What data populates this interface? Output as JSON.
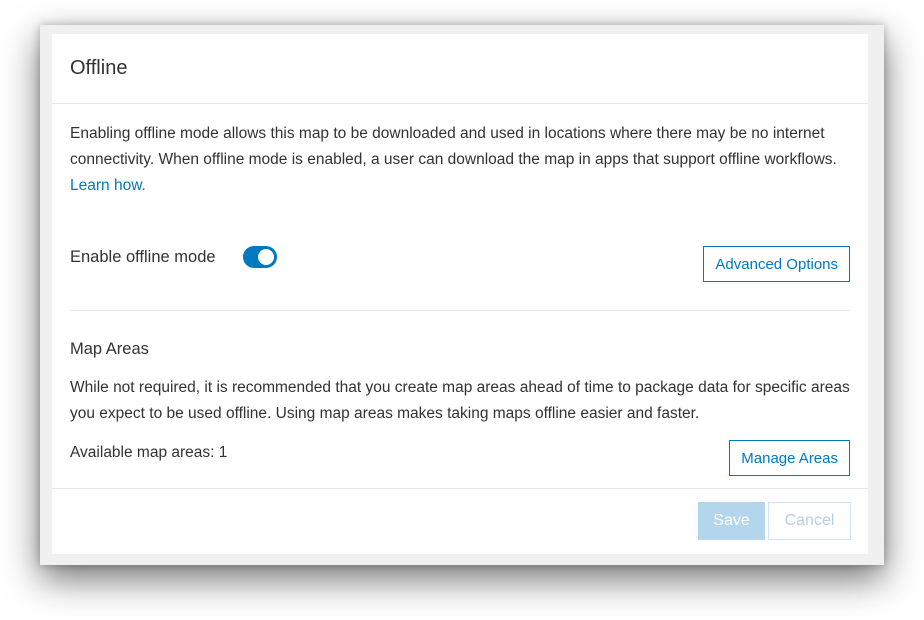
{
  "dialog": {
    "title": "Offline"
  },
  "offline": {
    "description": "Enabling offline mode allows this map to be downloaded and used in locations where there may be no internet connectivity. When offline mode is enabled, a user can download the map in apps that support offline workflows.",
    "learn_link": "Learn how.",
    "toggle_label": "Enable offline mode",
    "toggle_state": "on",
    "advanced_button": "Advanced Options"
  },
  "map_areas": {
    "title": "Map Areas",
    "description": "While not required, it is recommended that you create map areas ahead of time to package data for specific areas you expect to be used offline. Using map areas makes taking maps offline easier and faster.",
    "available_text": "Available map areas: 1",
    "manage_button": "Manage Areas"
  },
  "footer": {
    "save_label": "Save",
    "cancel_label": "Cancel"
  },
  "colors": {
    "accent": "#0079c1",
    "save_disabled": "#b3d6ec",
    "text": "#323232"
  }
}
